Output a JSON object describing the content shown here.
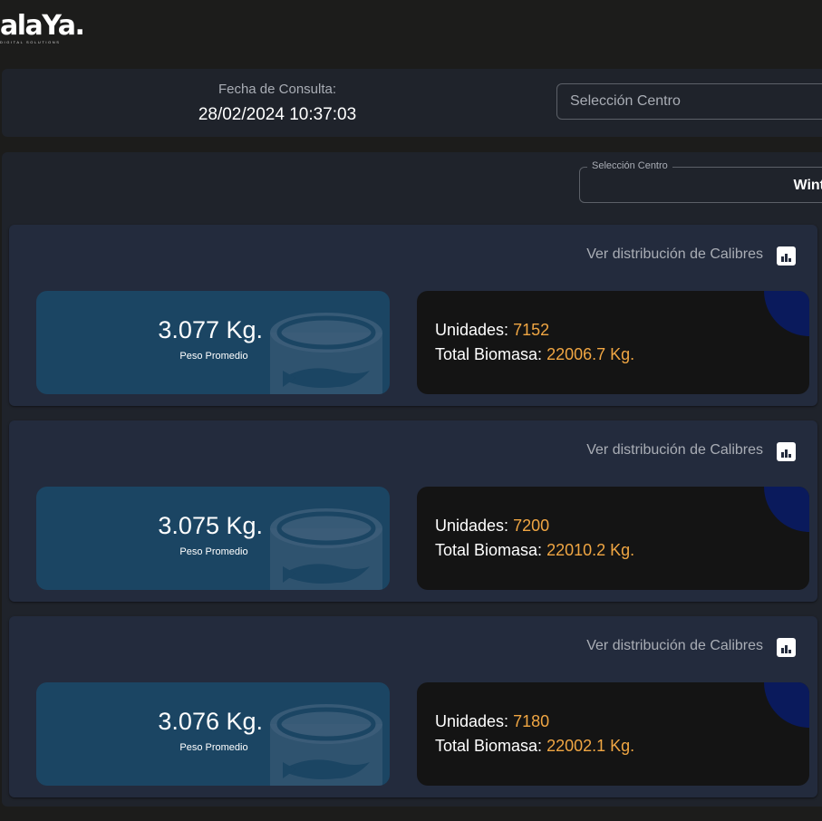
{
  "brand": {
    "logo_text": "alaYa.",
    "logo_subtitle": "DIGITAL SOLUTIONS"
  },
  "header": {
    "fecha_label": "Fecha de Consulta:",
    "fecha_value": "28/02/2024 10:37:03",
    "select_placeholder": "Selección Centro"
  },
  "main": {
    "select_legend": "Selección Centro",
    "select_value": "Wint"
  },
  "cards": [
    {
      "link_label": "Ver distribución de Calibres",
      "weight": "3.077 Kg.",
      "weight_label": "Peso Promedio",
      "units_label": "Unidades:",
      "units_value": "7152",
      "biomass_label": "Total Biomasa:",
      "biomass_value": "22006.7 Kg."
    },
    {
      "link_label": "Ver distribución de Calibres",
      "weight": "3.075 Kg.",
      "weight_label": "Peso Promedio",
      "units_label": "Unidades:",
      "units_value": "7200",
      "biomass_label": "Total Biomasa:",
      "biomass_value": "22010.2 Kg."
    },
    {
      "link_label": "Ver distribución de Calibres",
      "weight": "3.076 Kg.",
      "weight_label": "Peso Promedio",
      "units_label": "Unidades:",
      "units_value": "7180",
      "biomass_label": "Total Biomasa:",
      "biomass_value": "22002.1 Kg."
    }
  ],
  "icons": {
    "chart_button": "bar-chart-icon",
    "weight_decoration": "fish-can-icon"
  },
  "colors": {
    "background": "#1c1c1b",
    "panel": "#1f232b",
    "card": "#232b3d",
    "weight_box": "#1b4563",
    "stats_box": "#141414",
    "accent_value": "#f0a643",
    "corner_accent": "#0a1a5c"
  }
}
